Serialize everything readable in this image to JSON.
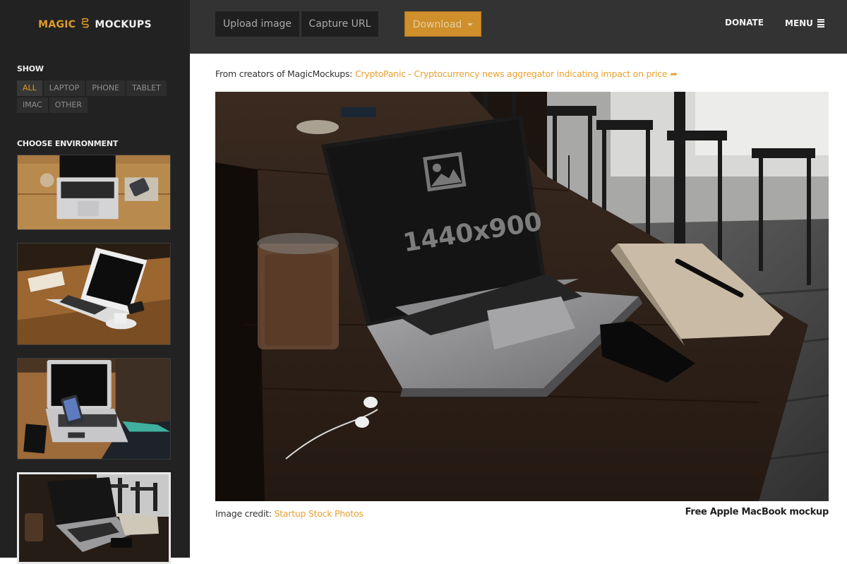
{
  "brand": {
    "part1": "MAGIC",
    "part2": "MOCKUPS",
    "accent_color": "#e09b2d"
  },
  "sidebar": {
    "show_title": "SHOW",
    "filters": [
      {
        "label": "ALL",
        "active": true
      },
      {
        "label": "LAPTOP",
        "active": false
      },
      {
        "label": "PHONE",
        "active": false
      },
      {
        "label": "TABLET",
        "active": false
      },
      {
        "label": "IMAC",
        "active": false
      },
      {
        "label": "OTHER",
        "active": false
      }
    ],
    "env_title": "CHOOSE ENVIRONMENT",
    "environments": [
      {
        "name": "laptop-on-pine-desk",
        "selected": false
      },
      {
        "name": "laptop-with-coffee",
        "selected": false
      },
      {
        "name": "person-with-phone-and-laptop",
        "selected": false
      },
      {
        "name": "macbook-in-cafe",
        "selected": true
      }
    ]
  },
  "toolbar": {
    "upload_label": "Upload image",
    "capture_label": "Capture URL",
    "download_label": "Download",
    "donate_label": "DONATE",
    "menu_label": "MENU"
  },
  "promo": {
    "prefix": "From creators of MagicMockups:",
    "link_text": "CryptoPanic - Cryptocurrency news aggregator indicating impact on price",
    "arrow": "➦"
  },
  "preview": {
    "screen_placeholder": "1440x900"
  },
  "footer": {
    "credit_prefix": "Image credit:",
    "credit_link": "Startup Stock Photos",
    "mockup_title": "Free Apple MacBook mockup"
  }
}
